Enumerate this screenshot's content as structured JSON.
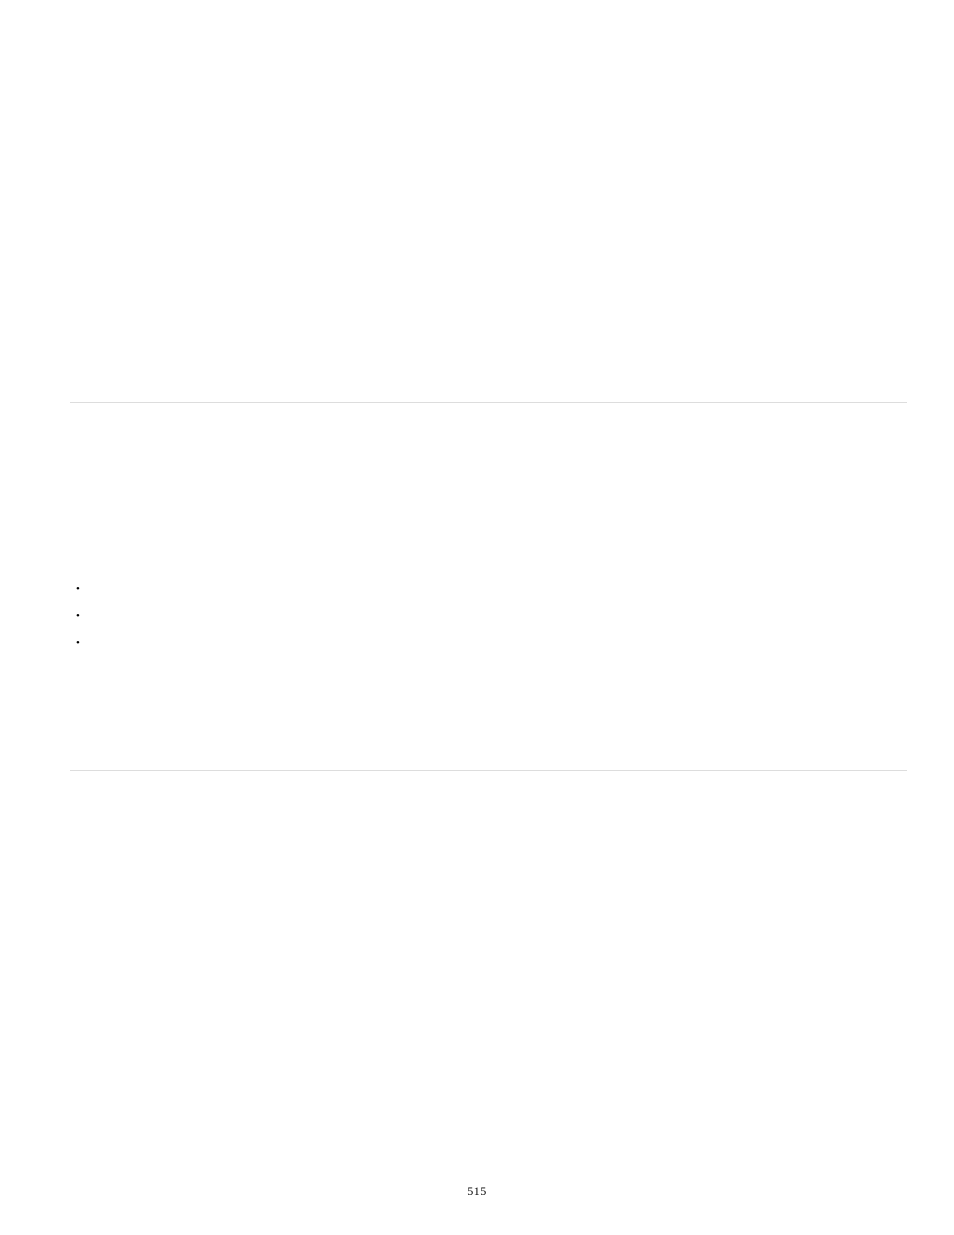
{
  "page_number": "515",
  "bullets": [
    "",
    "",
    ""
  ]
}
